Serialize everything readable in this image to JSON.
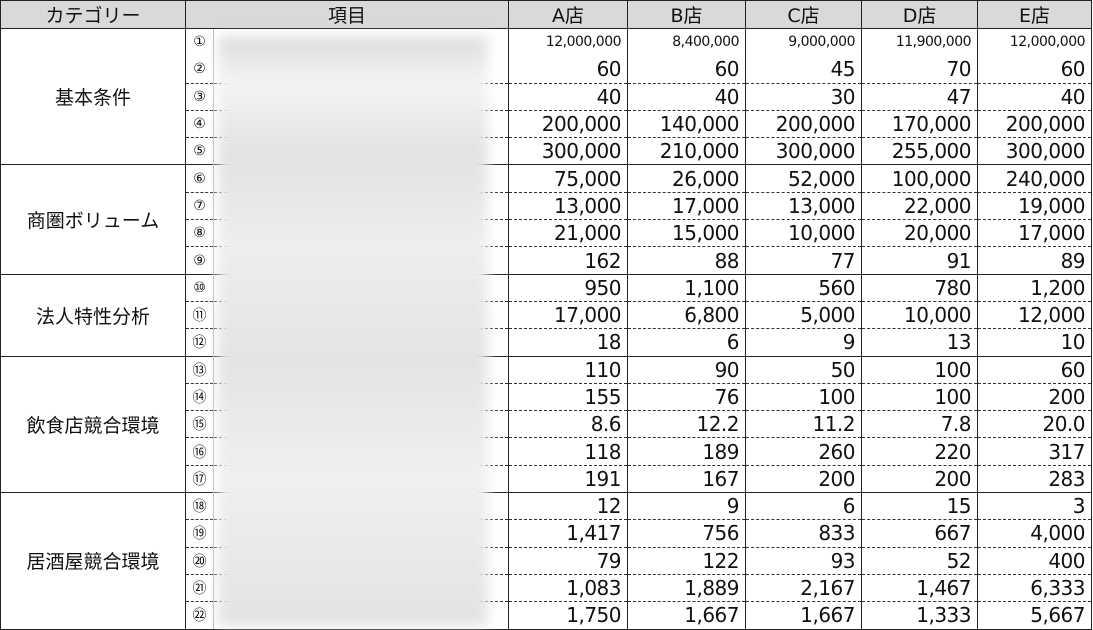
{
  "headers": {
    "category": "カテゴリー",
    "item": "項目",
    "stores": [
      "A店",
      "B店",
      "C店",
      "D店",
      "E店"
    ]
  },
  "groups": [
    {
      "category": "基本条件",
      "rows": [
        {
          "no": "①",
          "values": [
            "12,000,000",
            "8,400,000",
            "9,000,000",
            "11,900,000",
            "12,000,000"
          ]
        },
        {
          "no": "②",
          "values": [
            "60",
            "60",
            "45",
            "70",
            "60"
          ]
        },
        {
          "no": "③",
          "values": [
            "40",
            "40",
            "30",
            "47",
            "40"
          ]
        },
        {
          "no": "④",
          "values": [
            "200,000",
            "140,000",
            "200,000",
            "170,000",
            "200,000"
          ]
        },
        {
          "no": "⑤",
          "values": [
            "300,000",
            "210,000",
            "300,000",
            "255,000",
            "300,000"
          ]
        }
      ]
    },
    {
      "category": "商圏ボリューム",
      "rows": [
        {
          "no": "⑥",
          "values": [
            "75,000",
            "26,000",
            "52,000",
            "100,000",
            "240,000"
          ]
        },
        {
          "no": "⑦",
          "values": [
            "13,000",
            "17,000",
            "13,000",
            "22,000",
            "19,000"
          ]
        },
        {
          "no": "⑧",
          "values": [
            "21,000",
            "15,000",
            "10,000",
            "20,000",
            "17,000"
          ]
        },
        {
          "no": "⑨",
          "values": [
            "162",
            "88",
            "77",
            "91",
            "89"
          ]
        }
      ]
    },
    {
      "category": "法人特性分析",
      "rows": [
        {
          "no": "⑩",
          "values": [
            "950",
            "1,100",
            "560",
            "780",
            "1,200"
          ]
        },
        {
          "no": "⑪",
          "values": [
            "17,000",
            "6,800",
            "5,000",
            "10,000",
            "12,000"
          ]
        },
        {
          "no": "⑫",
          "values": [
            "18",
            "6",
            "9",
            "13",
            "10"
          ]
        }
      ]
    },
    {
      "category": "飲食店競合環境",
      "rows": [
        {
          "no": "⑬",
          "values": [
            "110",
            "90",
            "50",
            "100",
            "60"
          ]
        },
        {
          "no": "⑭",
          "values": [
            "155",
            "76",
            "100",
            "100",
            "200"
          ]
        },
        {
          "no": "⑮",
          "values": [
            "8.6",
            "12.2",
            "11.2",
            "7.8",
            "20.0"
          ]
        },
        {
          "no": "⑯",
          "values": [
            "118",
            "189",
            "260",
            "220",
            "317"
          ]
        },
        {
          "no": "⑰",
          "values": [
            "191",
            "167",
            "200",
            "200",
            "283"
          ]
        }
      ]
    },
    {
      "category": "居酒屋競合環境",
      "rows": [
        {
          "no": "⑱",
          "values": [
            "12",
            "9",
            "6",
            "15",
            "3"
          ]
        },
        {
          "no": "⑲",
          "values": [
            "1,417",
            "756",
            "833",
            "667",
            "4,000"
          ]
        },
        {
          "no": "⑳",
          "values": [
            "79",
            "122",
            "93",
            "52",
            "400"
          ]
        },
        {
          "no": "㉑",
          "values": [
            "1,083",
            "1,889",
            "2,167",
            "1,467",
            "6,333"
          ]
        },
        {
          "no": "㉒",
          "values": [
            "1,750",
            "1,667",
            "1,667",
            "1,333",
            "5,667"
          ]
        }
      ]
    }
  ]
}
